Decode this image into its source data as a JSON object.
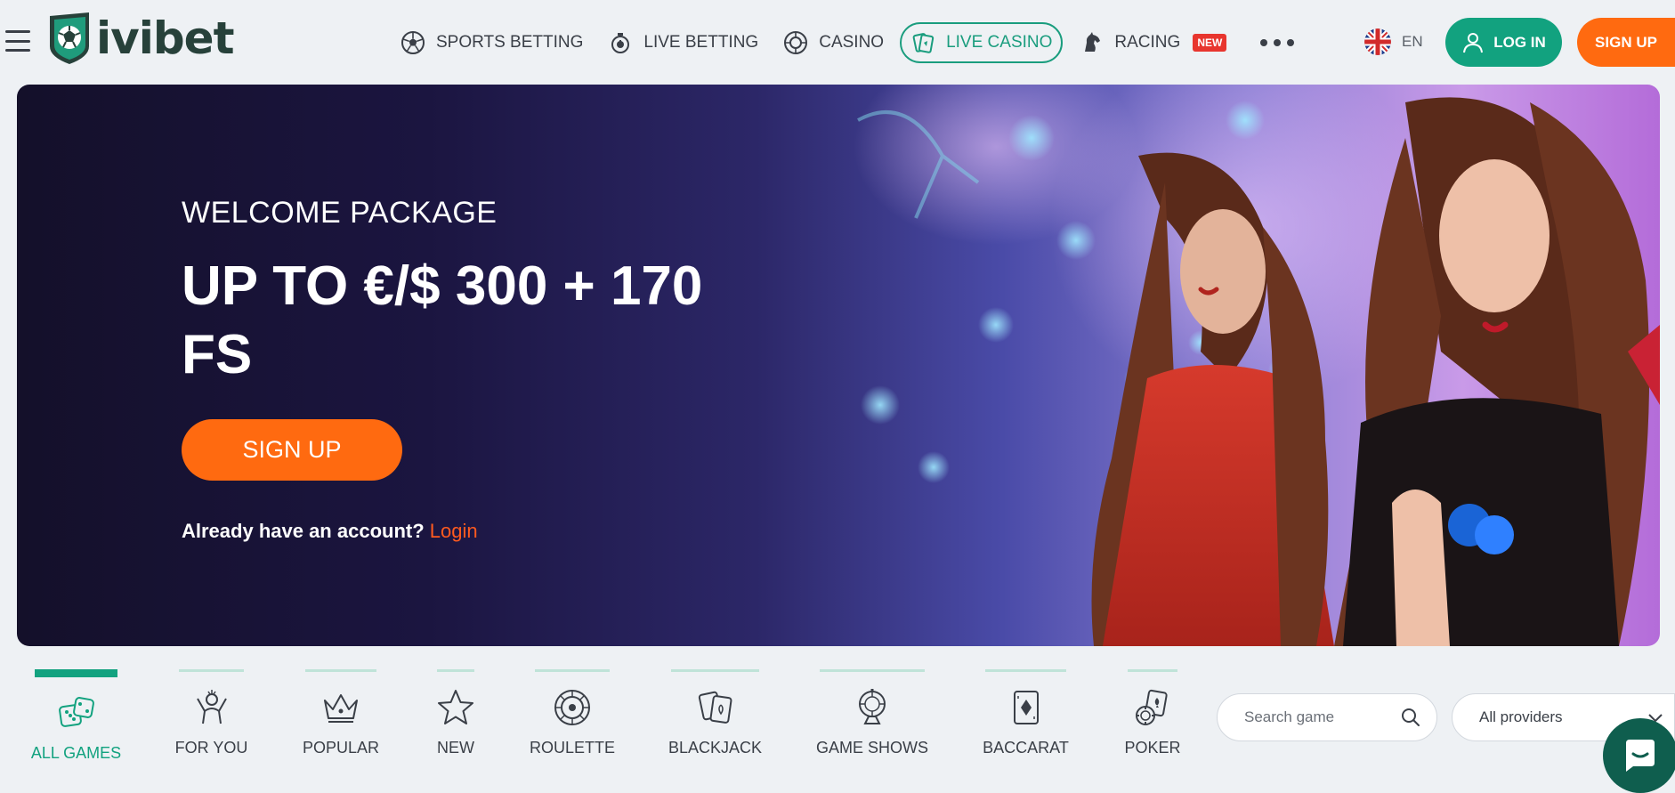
{
  "header": {
    "logo_text": "ivibet",
    "nav": [
      {
        "label": "SPORTS BETTING",
        "icon": "soccer-ball-icon"
      },
      {
        "label": "LIVE BETTING",
        "icon": "stopwatch-icon"
      },
      {
        "label": "CASINO",
        "icon": "roulette-icon"
      },
      {
        "label": "LIVE CASINO",
        "icon": "cards-icon",
        "active": true
      },
      {
        "label": "RACING",
        "icon": "horse-icon",
        "badge": "NEW"
      }
    ],
    "language": "EN",
    "login_label": "LOG IN",
    "signup_label": "SIGN UP"
  },
  "hero": {
    "subtitle": "WELCOME PACKAGE",
    "title": "UP TO €/$ 300 + 170 FS",
    "signup_label": "SIGN UP",
    "account_prompt": "Already have an account?",
    "login_link": "Login"
  },
  "categories": [
    {
      "label": "ALL GAMES",
      "icon": "dice-icon",
      "active": true
    },
    {
      "label": "FOR YOU",
      "icon": "cheering-person-icon"
    },
    {
      "label": "POPULAR",
      "icon": "crown-icon"
    },
    {
      "label": "NEW",
      "icon": "star-icon"
    },
    {
      "label": "ROULETTE",
      "icon": "roulette-wheel-icon"
    },
    {
      "label": "BLACKJACK",
      "icon": "playing-cards-icon"
    },
    {
      "label": "GAME SHOWS",
      "icon": "prize-wheel-icon"
    },
    {
      "label": "BACCARAT",
      "icon": "diamond-card-icon"
    },
    {
      "label": "POKER",
      "icon": "poker-chips-icon"
    }
  ],
  "search": {
    "placeholder": "Search game"
  },
  "providers": {
    "selected": "All providers"
  },
  "colors": {
    "brand_green": "#12a27f",
    "accent_orange": "#ff6a10",
    "new_badge": "#e8352e",
    "logo_dark": "#27413a"
  }
}
